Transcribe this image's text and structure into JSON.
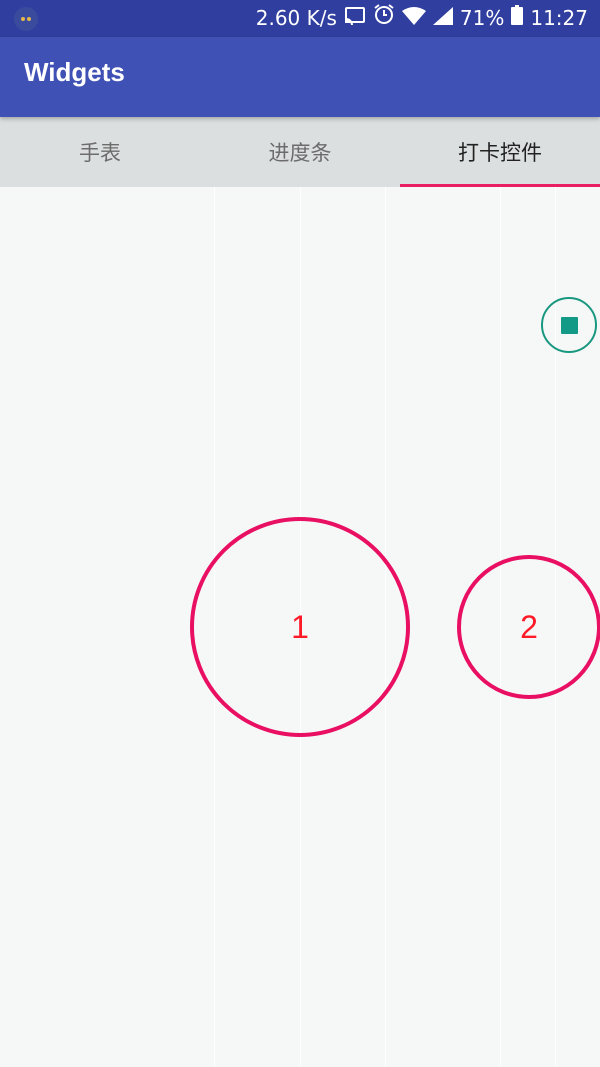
{
  "status_bar": {
    "network_speed": "2.60 K/s",
    "battery": "71%",
    "time": "11:27",
    "icons": [
      "cast-icon",
      "alarm-icon",
      "wifi-icon",
      "signal-icon",
      "battery-icon"
    ],
    "background": "#303f9f"
  },
  "app_bar": {
    "title": "Widgets",
    "background": "#3f51b5"
  },
  "tabs": [
    {
      "label": "手表",
      "active": false
    },
    {
      "label": "进度条",
      "active": false
    },
    {
      "label": "打卡控件",
      "active": true
    }
  ],
  "tab_indicator_color": "#e91e63",
  "content": {
    "mini_button": {
      "icon": "stop-square-icon",
      "accent": "#139a86"
    },
    "punch_buttons": [
      {
        "label": "1",
        "color": "#e90f62"
      },
      {
        "label": "2",
        "color": "#e90f62"
      }
    ]
  }
}
